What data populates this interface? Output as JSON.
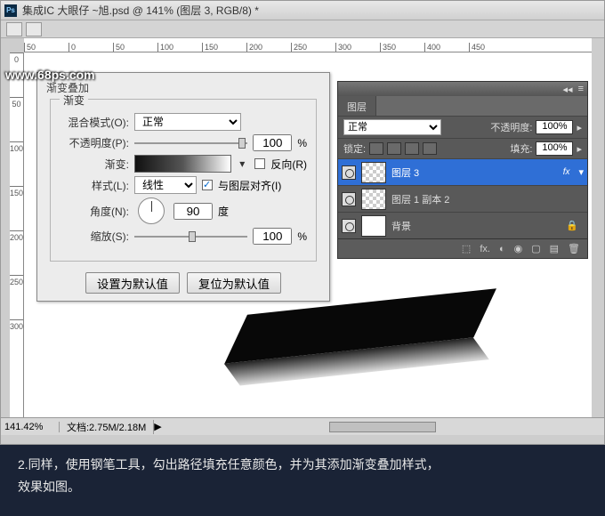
{
  "window": {
    "title": "集成IC    大眼仔 ~旭.psd @ 141% (图层 3, RGB/8) *"
  },
  "ruler_h": [
    "50",
    "0",
    "50",
    "100",
    "150",
    "200",
    "250",
    "300",
    "350",
    "400",
    "450"
  ],
  "ruler_v": [
    "0",
    "50",
    "100",
    "150",
    "200",
    "250",
    "300"
  ],
  "dialog": {
    "title": "渐变叠加",
    "legend": "渐变",
    "blend_label": "混合模式(O):",
    "blend_value": "正常",
    "opacity_label": "不透明度(P):",
    "opacity_value": "100",
    "percent": "%",
    "gradient_label": "渐变:",
    "reverse_label": "反向(R)",
    "style_label": "样式(L):",
    "style_value": "线性",
    "align_label": "与图层对齐(I)",
    "angle_label": "角度(N):",
    "angle_value": "90",
    "degree": "度",
    "scale_label": "缩放(S):",
    "scale_value": "100",
    "btn_default": "设置为默认值",
    "btn_reset": "复位为默认值"
  },
  "panel": {
    "tab": "图层",
    "blend_value": "正常",
    "opacity_label": "不透明度:",
    "opacity_value": "100%",
    "lock_label": "锁定:",
    "fill_label": "填充:",
    "fill_value": "100%",
    "layers": [
      {
        "name": "图层 3",
        "fx": "fx",
        "selected": true
      },
      {
        "name": "图层 1 副本 2"
      },
      {
        "name": "背景",
        "locked": true,
        "solid": true
      }
    ]
  },
  "status": {
    "zoom": "141.42%",
    "doc": "文档:2.75M/2.18M"
  },
  "watermark": "www.68ps.com",
  "caption_line1": "2.同样，使用钢笔工具，勾出路径填充任意颜色，并为其添加渐变叠加样式，",
  "caption_line2": "效果如图。"
}
